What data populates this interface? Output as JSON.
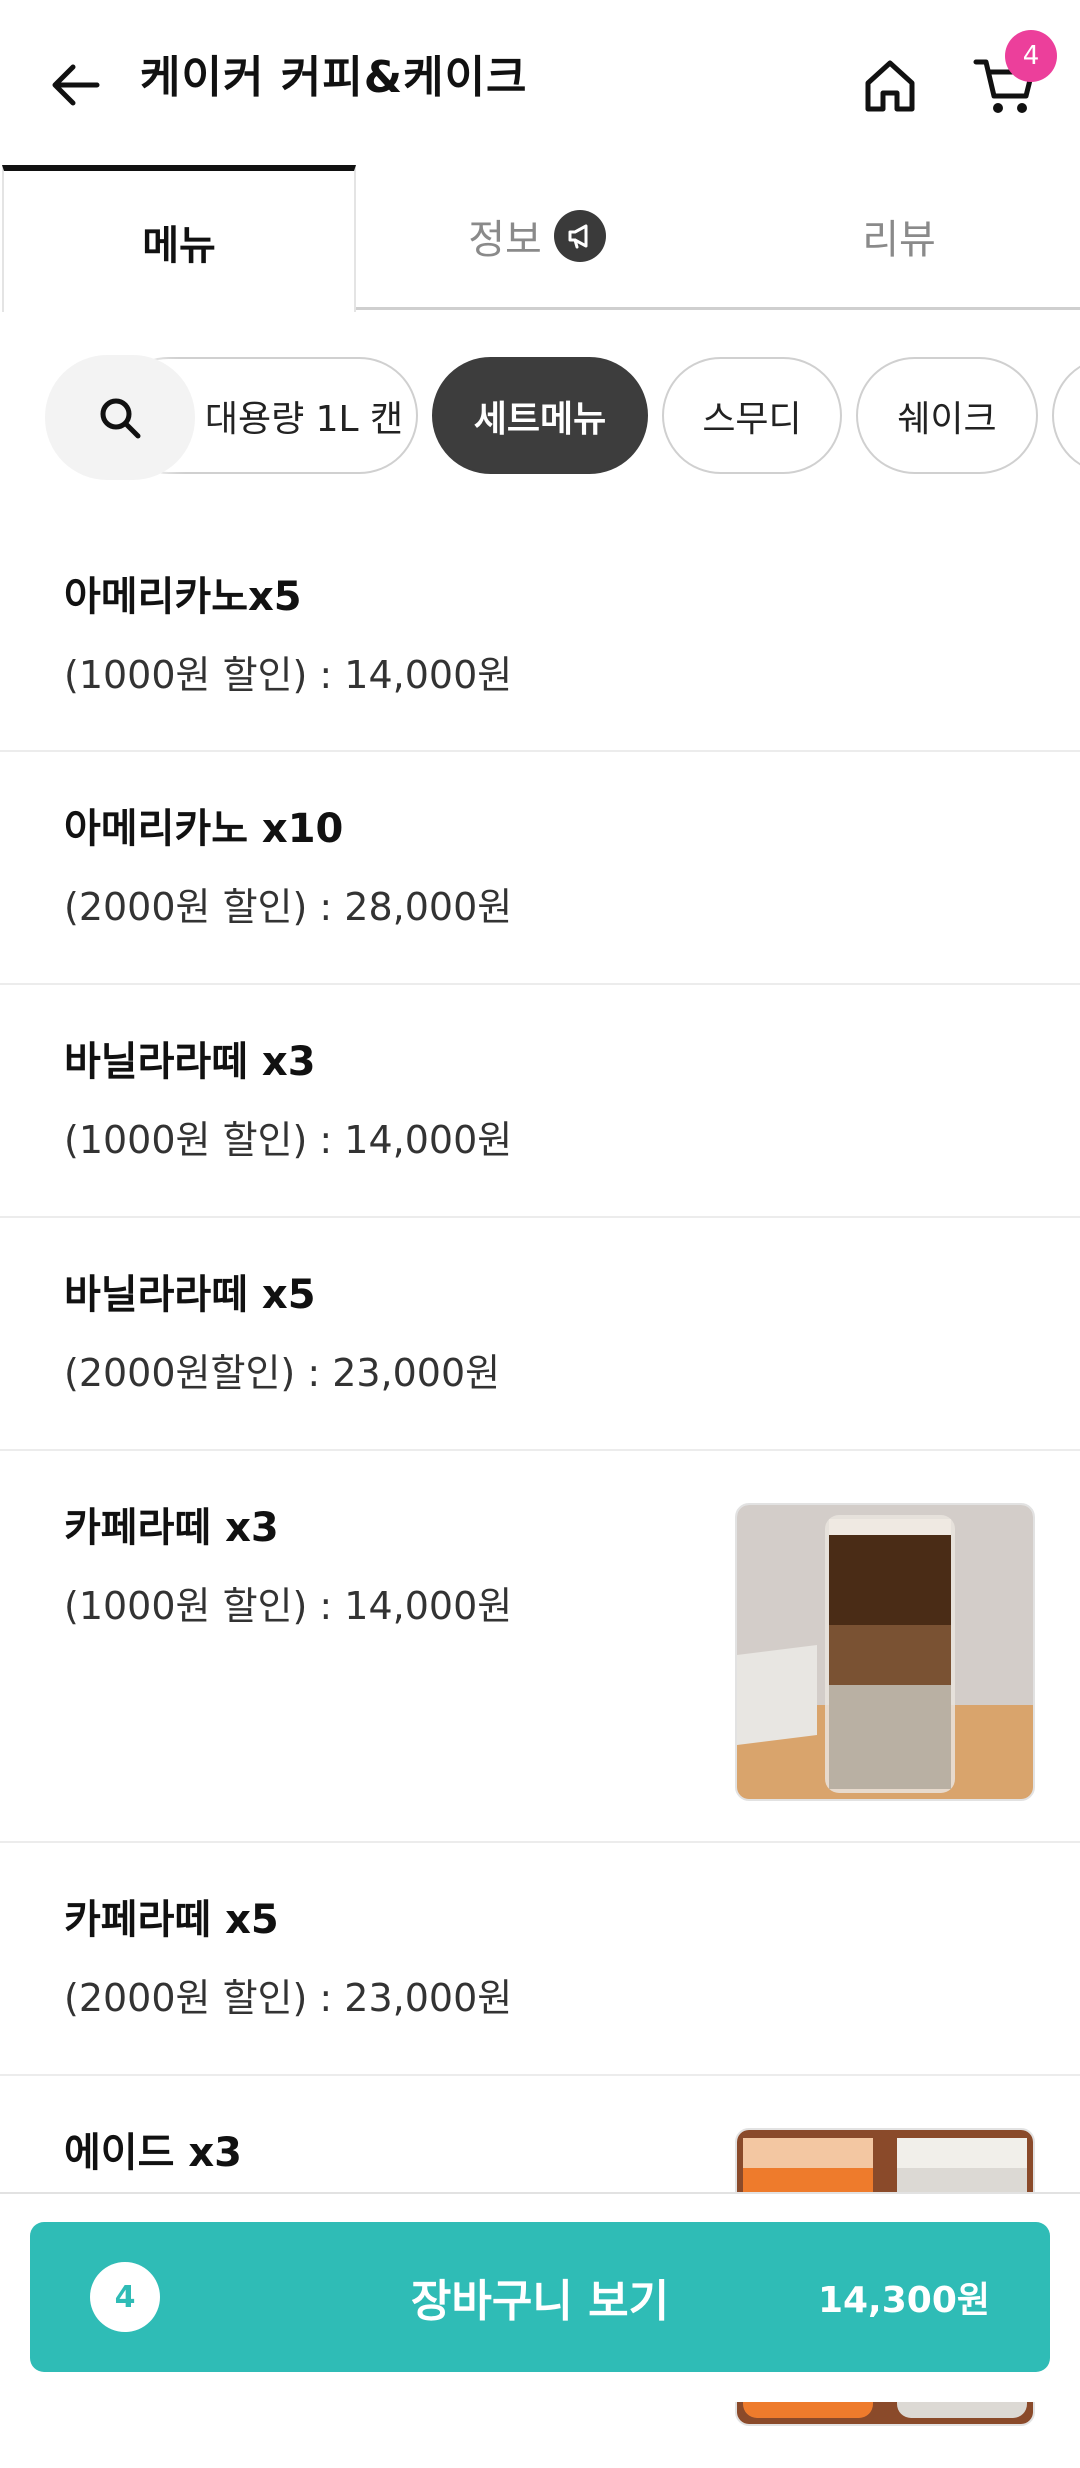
{
  "header": {
    "title": "케이커 커피&케이크",
    "cart_badge": "4",
    "icons": [
      "back-arrow-icon",
      "home-icon",
      "cart-icon"
    ]
  },
  "tabs": [
    {
      "label": "메뉴",
      "selected": true
    },
    {
      "label": "정보",
      "selected": false,
      "icon": "megaphone-icon"
    },
    {
      "label": "리뷰",
      "selected": false
    }
  ],
  "categories": {
    "search_icon": "search-icon",
    "chips": [
      {
        "label": "대용량 1L 캔",
        "selected": false
      },
      {
        "label": "세트메뉴",
        "selected": true
      },
      {
        "label": "스무디",
        "selected": false
      },
      {
        "label": "쉐이크",
        "selected": false
      }
    ]
  },
  "menu_items": [
    {
      "name": "아메리카노x5",
      "desc": "(1000원 할인) : 14,000원"
    },
    {
      "name": "아메리카노 x10",
      "desc": "(2000원 할인) : 28,000원"
    },
    {
      "name": "바닐라라떼 x3",
      "desc": "(1000원 할인) : 14,000원"
    },
    {
      "name": "바닐라라떼 x5",
      "desc": "(2000원할인) : 23,000원"
    },
    {
      "name": "카페라떼 x3",
      "desc": "(1000원 할인) : 14,000원",
      "has_photo": true
    },
    {
      "name": "카페라떼 x5",
      "desc": "(2000원 할인) : 23,000원"
    },
    {
      "name": "에이드 x3",
      "desc": "",
      "has_photo": true
    }
  ],
  "cart_bar": {
    "count": "4",
    "label": "장바구니 보기",
    "total": "14,300원",
    "color": "#2fbcb6"
  },
  "colors": {
    "badge": "#ec3f9b",
    "chip_active": "#3d3d3d"
  }
}
